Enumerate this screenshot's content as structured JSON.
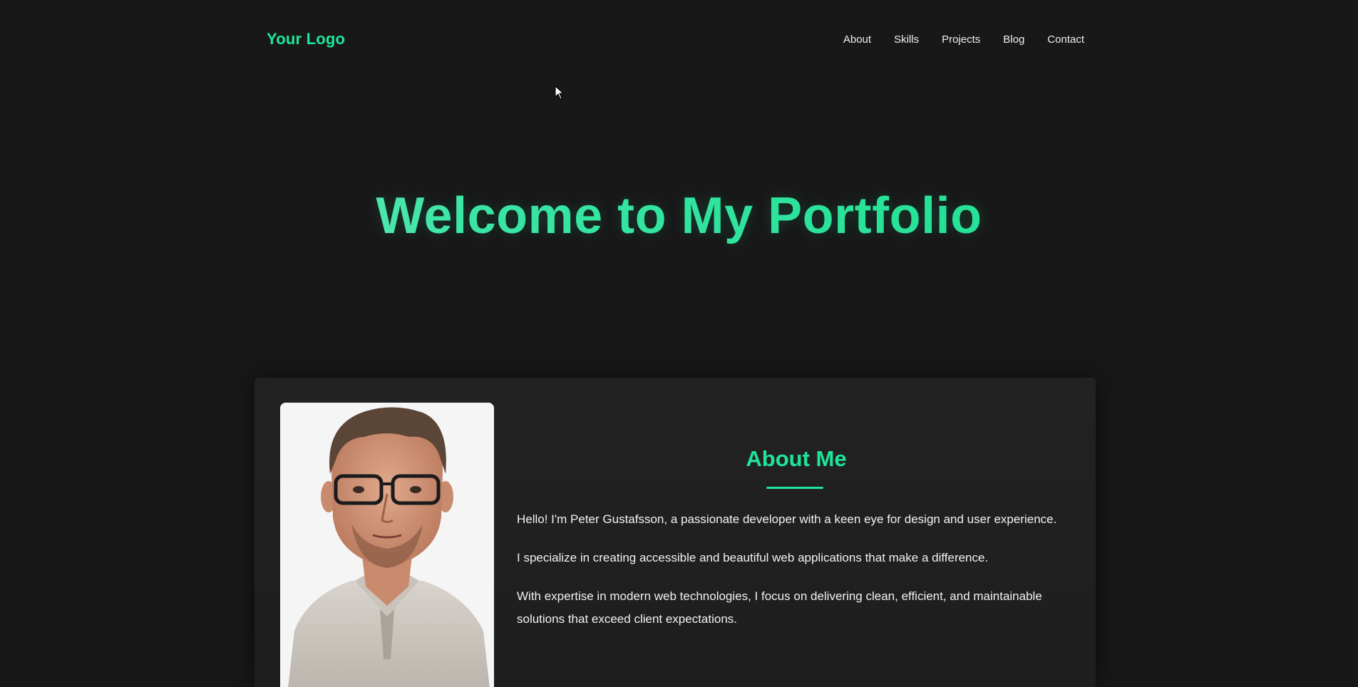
{
  "colors": {
    "accent": "#1ee59a",
    "background": "#181818",
    "card": "#212121",
    "text": "#f2f2f2"
  },
  "header": {
    "logo": "Your Logo",
    "nav": [
      {
        "label": "About"
      },
      {
        "label": "Skills"
      },
      {
        "label": "Projects"
      },
      {
        "label": "Blog"
      },
      {
        "label": "Contact"
      }
    ]
  },
  "hero": {
    "title": "Welcome to My Portfolio"
  },
  "about": {
    "heading": "About Me",
    "paragraphs": [
      "Hello! I'm Peter Gustafsson, a passionate developer with a keen eye for design and user experience.",
      "I specialize in creating accessible and beautiful web applications that make a difference.",
      "With expertise in modern web technologies, I focus on delivering clean, efficient, and maintainable solutions that exceed client expectations."
    ]
  }
}
